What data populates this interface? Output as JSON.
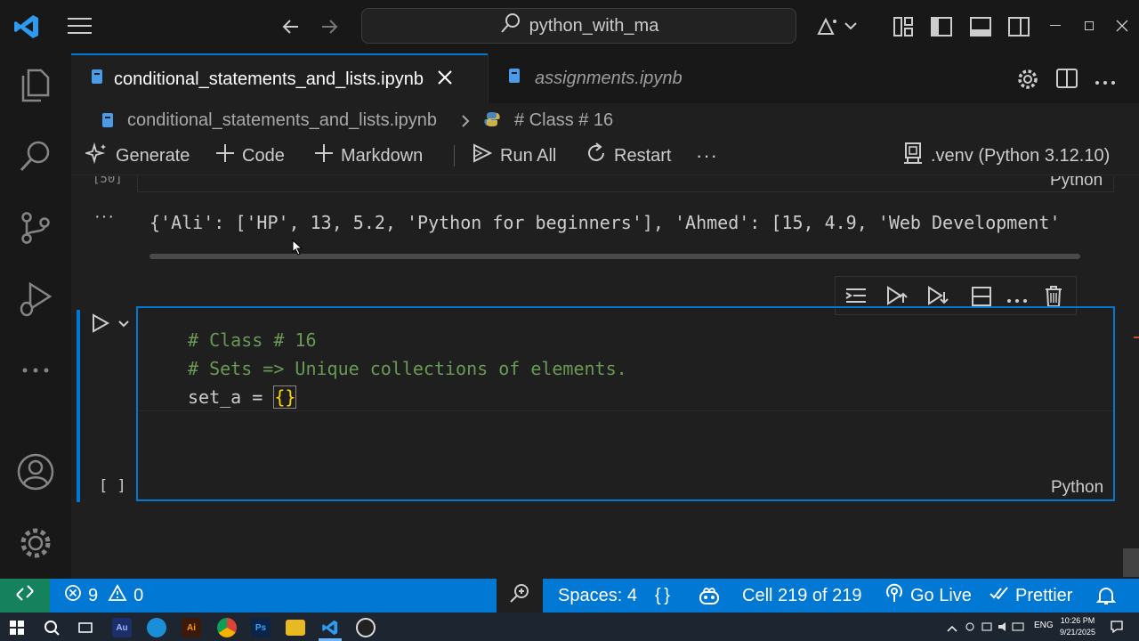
{
  "titlebar": {
    "search_text": "python_with_ma"
  },
  "tabs": [
    {
      "label": "conditional_statements_and_lists.ipynb",
      "active": true
    },
    {
      "label": "assignments.ipynb",
      "active": false
    }
  ],
  "breadcrumb": {
    "file": "conditional_statements_and_lists.ipynb",
    "section": "# Class # 16"
  },
  "toolbar": {
    "generate": "Generate",
    "code": "Code",
    "markdown": "Markdown",
    "run_all": "Run All",
    "restart": "Restart",
    "more": "···",
    "kernel": ".venv (Python 3.12.10)"
  },
  "prev_cell": {
    "exec_count": "[50]",
    "language": "Python",
    "output_marker": "···",
    "output_text": "{'Ali': ['HP', 13, 5.2, 'Python for beginners'], 'Ahmed': [15, 4.9, 'Web Development'"
  },
  "cell": {
    "exec_count": "[ ]",
    "language": "Python",
    "code": {
      "line1": "# Class # 16",
      "line2": "# Sets => Unique collections of elements.",
      "line3_var": "set_a",
      "line3_op": " = ",
      "line3_val": "{}"
    }
  },
  "statusbar": {
    "errors": "9",
    "warnings": "0",
    "spaces": "Spaces: 4",
    "braces": "{ }",
    "cell_pos": "Cell 219 of 219",
    "go_live": "Go Live",
    "prettier": "Prettier"
  },
  "taskbar": {
    "time": "10:26 PM",
    "date": "9/21/2025",
    "lang": "ENG"
  },
  "colors": {
    "accent": "#0078d4",
    "statusbar": "#0078d4",
    "comment": "#6a9955",
    "variable": "#9cdcfe",
    "bracket": "#ffd700"
  }
}
